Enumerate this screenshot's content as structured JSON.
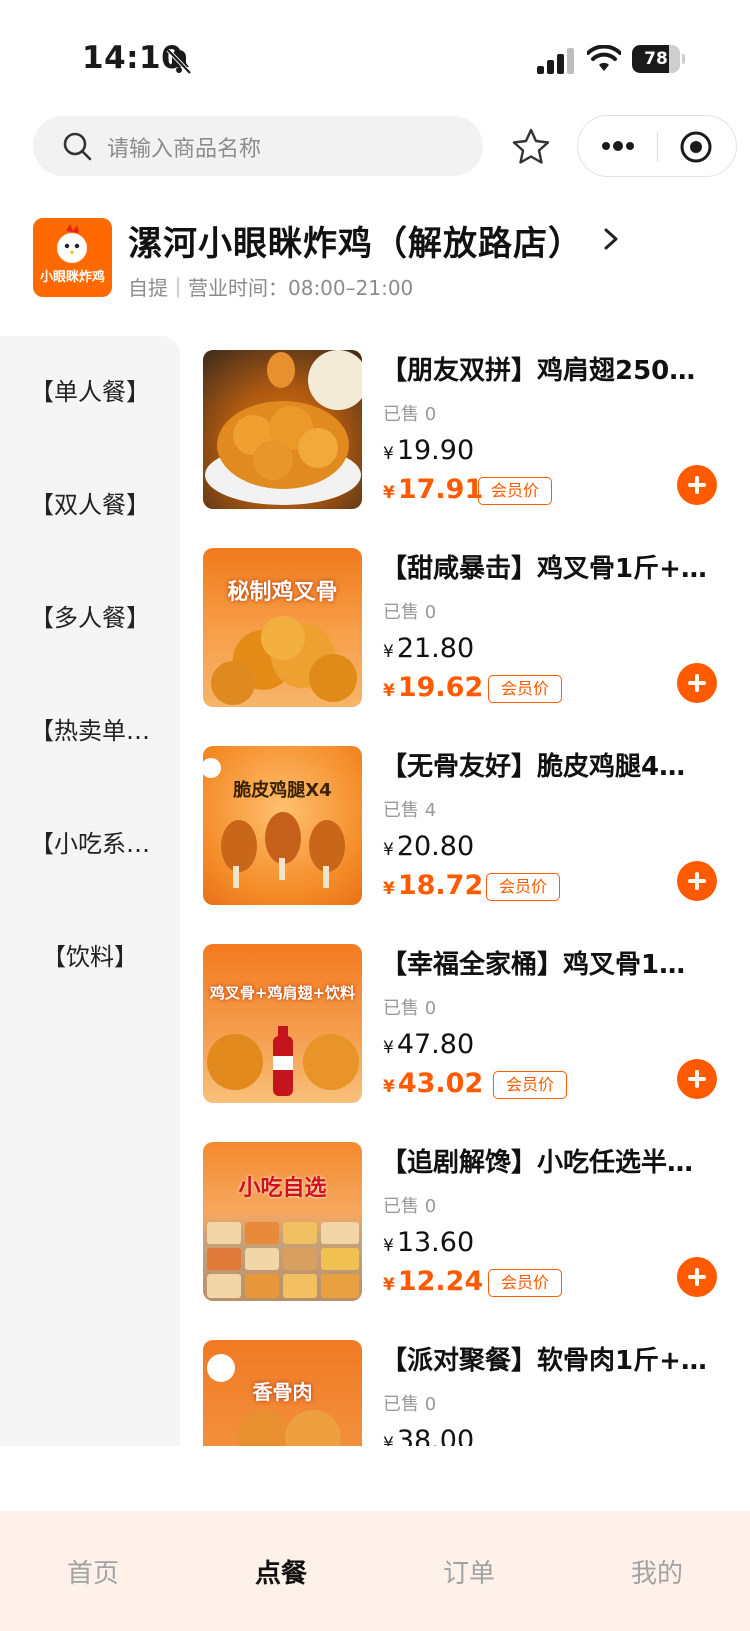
{
  "status_bar": {
    "time": "14:10",
    "battery": "78",
    "battery_level": 0.78
  },
  "search": {
    "placeholder": "请输入商品名称"
  },
  "store": {
    "logo_text": "小眼眯炸鸡",
    "name": "漯河小眼眯炸鸡（解放路店）",
    "meta": "自提｜营业时间：08:00–21:00"
  },
  "categories": [
    "【单人餐】",
    "【双人餐】",
    "【多人餐】",
    "【热卖单…",
    "【小吃系…",
    "【饮料】"
  ],
  "products": [
    {
      "title": "【朋友双拼】鸡肩翅250…",
      "sold": "已售 0",
      "currency": "¥",
      "price": "19.90",
      "member_price": "17.91",
      "badge": "会员价",
      "image_text": ""
    },
    {
      "title": "【甜咸暴击】鸡叉骨1斤+…",
      "sold": "已售 0",
      "currency": "¥",
      "price": "21.80",
      "member_price": "19.62",
      "badge": "会员价",
      "image_text": "秘制鸡叉骨"
    },
    {
      "title": "【无骨友好】脆皮鸡腿4…",
      "sold": "已售 4",
      "currency": "¥",
      "price": "20.80",
      "member_price": "18.72",
      "badge": "会员价",
      "image_text": "脆皮鸡腿X4"
    },
    {
      "title": "【幸福全家桶】鸡叉骨1…",
      "sold": "已售 0",
      "currency": "¥",
      "price": "47.80",
      "member_price": "43.02",
      "badge": "会员价",
      "image_text": "鸡叉骨+鸡肩翅+饮料"
    },
    {
      "title": "【追剧解馋】小吃任选半…",
      "sold": "已售 0",
      "currency": "¥",
      "price": "13.60",
      "member_price": "12.24",
      "badge": "会员价",
      "image_text": "小吃自选"
    },
    {
      "title": "【派对聚餐】软骨肉1斤+…",
      "sold": "已售 0",
      "currency": "¥",
      "price": "38.00",
      "member_price": "",
      "badge": "",
      "image_text": "香骨肉"
    }
  ],
  "tabs": [
    {
      "label": "首页",
      "active": false
    },
    {
      "label": "点餐",
      "active": true
    },
    {
      "label": "订单",
      "active": false
    },
    {
      "label": "我的",
      "active": false
    }
  ],
  "colors": {
    "accent": "#ff5a00",
    "tabbar_bg": "#fdf1ea",
    "sidebar_bg": "#f5f5f5"
  }
}
